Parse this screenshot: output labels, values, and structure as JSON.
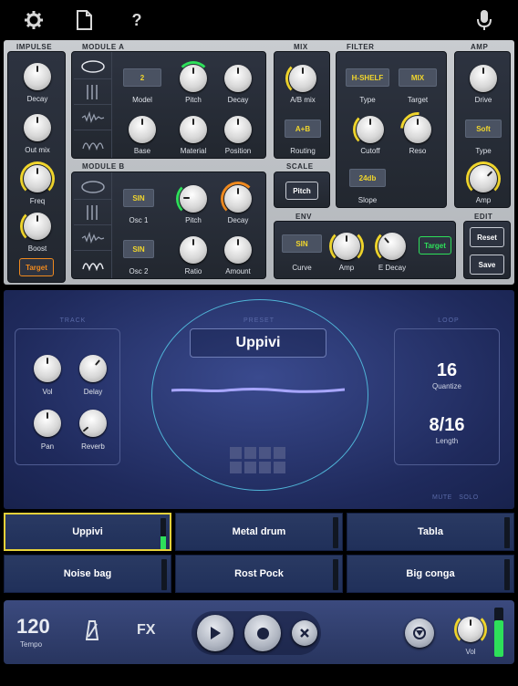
{
  "topbar": {
    "icons": [
      "gear-icon",
      "document-icon",
      "help-icon",
      "microphone-icon"
    ],
    "help_glyph": "?"
  },
  "impulse": {
    "title": "IMPULSE",
    "decay": "Decay",
    "out_mix": "Out mix",
    "freq": "Freq",
    "boost": "Boost",
    "target": "Target"
  },
  "module_a": {
    "title": "MODULE A",
    "model_value": "2",
    "model": "Model",
    "pitch": "Pitch",
    "decay": "Decay",
    "base": "Base",
    "material": "Material",
    "position": "Position"
  },
  "module_b": {
    "title": "MODULE B",
    "osc1_value": "SIN",
    "osc1": "Osc 1",
    "pitch": "Pitch",
    "decay": "Decay",
    "osc2_value": "SIN",
    "osc2": "Osc 2",
    "ratio": "Ratio",
    "amount": "Amount"
  },
  "mix": {
    "title": "MIX",
    "ab_mix": "A/B mix",
    "routing_value": "A+B",
    "routing": "Routing"
  },
  "scale": {
    "title": "SCALE",
    "pitch": "Pitch"
  },
  "filter": {
    "title": "FILTER",
    "type_value": "H-SHELF",
    "type": "Type",
    "target_value": "MIX",
    "target": "Target",
    "cutoff": "Cutoff",
    "reso": "Reso",
    "slope_value": "24db",
    "slope": "Slope"
  },
  "amp": {
    "title": "AMP",
    "drive": "Drive",
    "type_value": "Soft",
    "type": "Type",
    "amp": "Amp"
  },
  "env": {
    "title": "ENV",
    "curve_value": "SIN",
    "curve": "Curve",
    "amp": "Amp",
    "edecay": "E Decay",
    "target": "Target"
  },
  "edit": {
    "title": "EDIT",
    "reset": "Reset",
    "save": "Save"
  },
  "track": {
    "title": "TRACK",
    "vol": "Vol",
    "delay": "Delay",
    "pan": "Pan",
    "reverb": "Reverb"
  },
  "preset": {
    "title": "PRESET",
    "name": "Uppivi"
  },
  "loop": {
    "title": "LOOP",
    "quantize_value": "16",
    "quantize": "Quantize",
    "length_value": "8/16",
    "length": "Length"
  },
  "mute_solo": {
    "mute": "MUTE",
    "solo": "SOLO"
  },
  "presets": [
    "Uppivi",
    "Metal drum",
    "Tabla",
    "Noise bag",
    "Rost Pock",
    "Big conga"
  ],
  "transport": {
    "tempo_value": "120",
    "tempo": "Tempo",
    "fx": "FX",
    "vol": "Vol"
  },
  "colors": {
    "accent_yellow": "#f1d62c",
    "accent_orange": "#f08a1e",
    "accent_green": "#2ee05a",
    "waveform": "#a8a6ff"
  }
}
